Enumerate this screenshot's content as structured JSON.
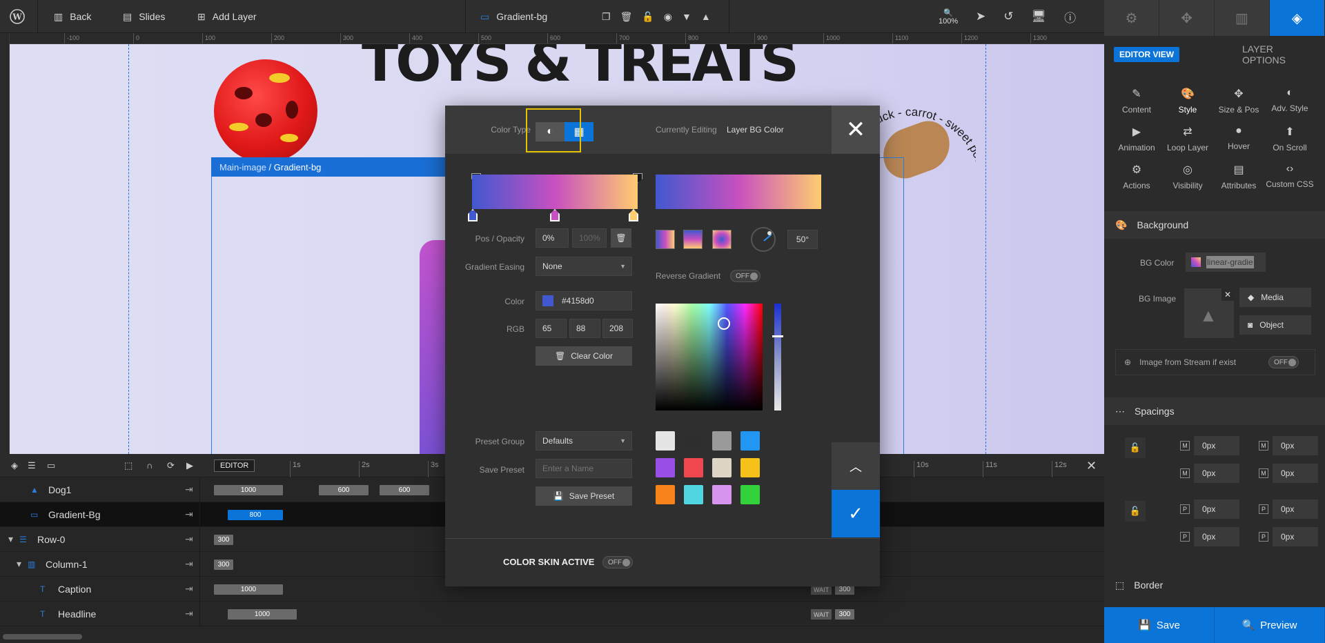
{
  "topbar": {
    "back": "Back",
    "slides": "Slides",
    "add_layer": "Add Layer",
    "layer_name": "Gradient-bg",
    "zoom": "100%"
  },
  "ruler": {
    "labels": [
      "-100",
      "0",
      "100",
      "200",
      "300",
      "400",
      "500",
      "600",
      "700",
      "800",
      "900",
      "1000",
      "1100",
      "1200",
      "1300"
    ]
  },
  "canvas": {
    "headline": "TOYS & TREATS",
    "breadcrumb_parent": "Main-image",
    "breadcrumb_sep": " / ",
    "breadcrumb_current": "Gradient-bg",
    "arc_text": "duck - carrot - sweet potato -"
  },
  "dialog": {
    "color_type_label": "Color Type",
    "currently_editing_label": "Currently Editing",
    "currently_editing_value": "Layer BG Color",
    "gradient": {
      "colors": [
        "#4158d0",
        "#c850c0",
        "#ffcc70"
      ],
      "angle": 50
    },
    "pos_opacity_label": "Pos / Opacity",
    "pos_value": "0%",
    "opacity_value": "100%",
    "gradient_easing_label": "Gradient Easing",
    "gradient_easing_value": "None",
    "reverse_gradient_label": "Reverse Gradient",
    "reverse_toggle": "OFF",
    "angle_value": "50°",
    "color_label": "Color",
    "color_hex": "#4158d0",
    "rgb_label": "RGB",
    "rgb_r": "65",
    "rgb_g": "88",
    "rgb_b": "208",
    "clear_color": "Clear Color",
    "preset_group_label": "Preset Group",
    "preset_group_value": "Defaults",
    "save_preset_label": "Save Preset",
    "preset_name_placeholder": "Enter a Name",
    "save_preset_button": "Save Preset",
    "color_skin_label": "COLOR SKIN ACTIVE",
    "color_skin_toggle": "OFF",
    "swatches": [
      "#e5e5e5",
      "#2e2e2e",
      "#9a9a9a",
      "#2196f3",
      "#9a4fe6",
      "#f0474f",
      "#ddd5c5",
      "#f6c21a",
      "#f7831a",
      "#4fd6e0",
      "#d794ee",
      "#34d23a"
    ]
  },
  "timeline": {
    "editor_label": "EDITOR",
    "ticks": [
      "1s",
      "2s",
      "3s",
      "10s",
      "11s",
      "12s"
    ],
    "rows": [
      {
        "name": "Dog1",
        "bar": "1000",
        "extra1": "600",
        "extra2": "600"
      },
      {
        "name": "Gradient-Bg",
        "bar": "800"
      },
      {
        "name": "Row-0",
        "bar": "300"
      },
      {
        "name": "Column-1",
        "bar": "300"
      },
      {
        "name": "Caption",
        "bar": "1000",
        "wait": "WAIT",
        "wait_val": "300"
      },
      {
        "name": "Headline",
        "bar": "1000",
        "wait": "WAIT",
        "wait_val": "300"
      }
    ]
  },
  "rpanel": {
    "editor_view": "EDITOR VIEW",
    "layer_options": "LAYER OPTIONS",
    "tiles": [
      "Content",
      "Style",
      "Size & Pos",
      "Adv. Style",
      "Animation",
      "Loop Layer",
      "Hover",
      "On Scroll",
      "Actions",
      "Visibility",
      "Attributes",
      "Custom CSS"
    ],
    "background_title": "Background",
    "bg_color_label": "BG Color",
    "bg_color_value": "linear-gradie",
    "bg_image_label": "BG Image",
    "media_button": "Media",
    "object_button": "Object",
    "image_stream_label": "Image from Stream if exist",
    "image_stream_toggle": "OFF",
    "spacings_title": "Spacings",
    "spacing_values": [
      "0px",
      "0px",
      "0px",
      "0px",
      "0px",
      "0px",
      "0px",
      "0px"
    ],
    "spacing_badges": [
      "M",
      "M",
      "M",
      "M",
      "P",
      "P",
      "P",
      "P"
    ],
    "border_title": "Border"
  },
  "footer": {
    "save": "Save",
    "preview": "Preview"
  }
}
